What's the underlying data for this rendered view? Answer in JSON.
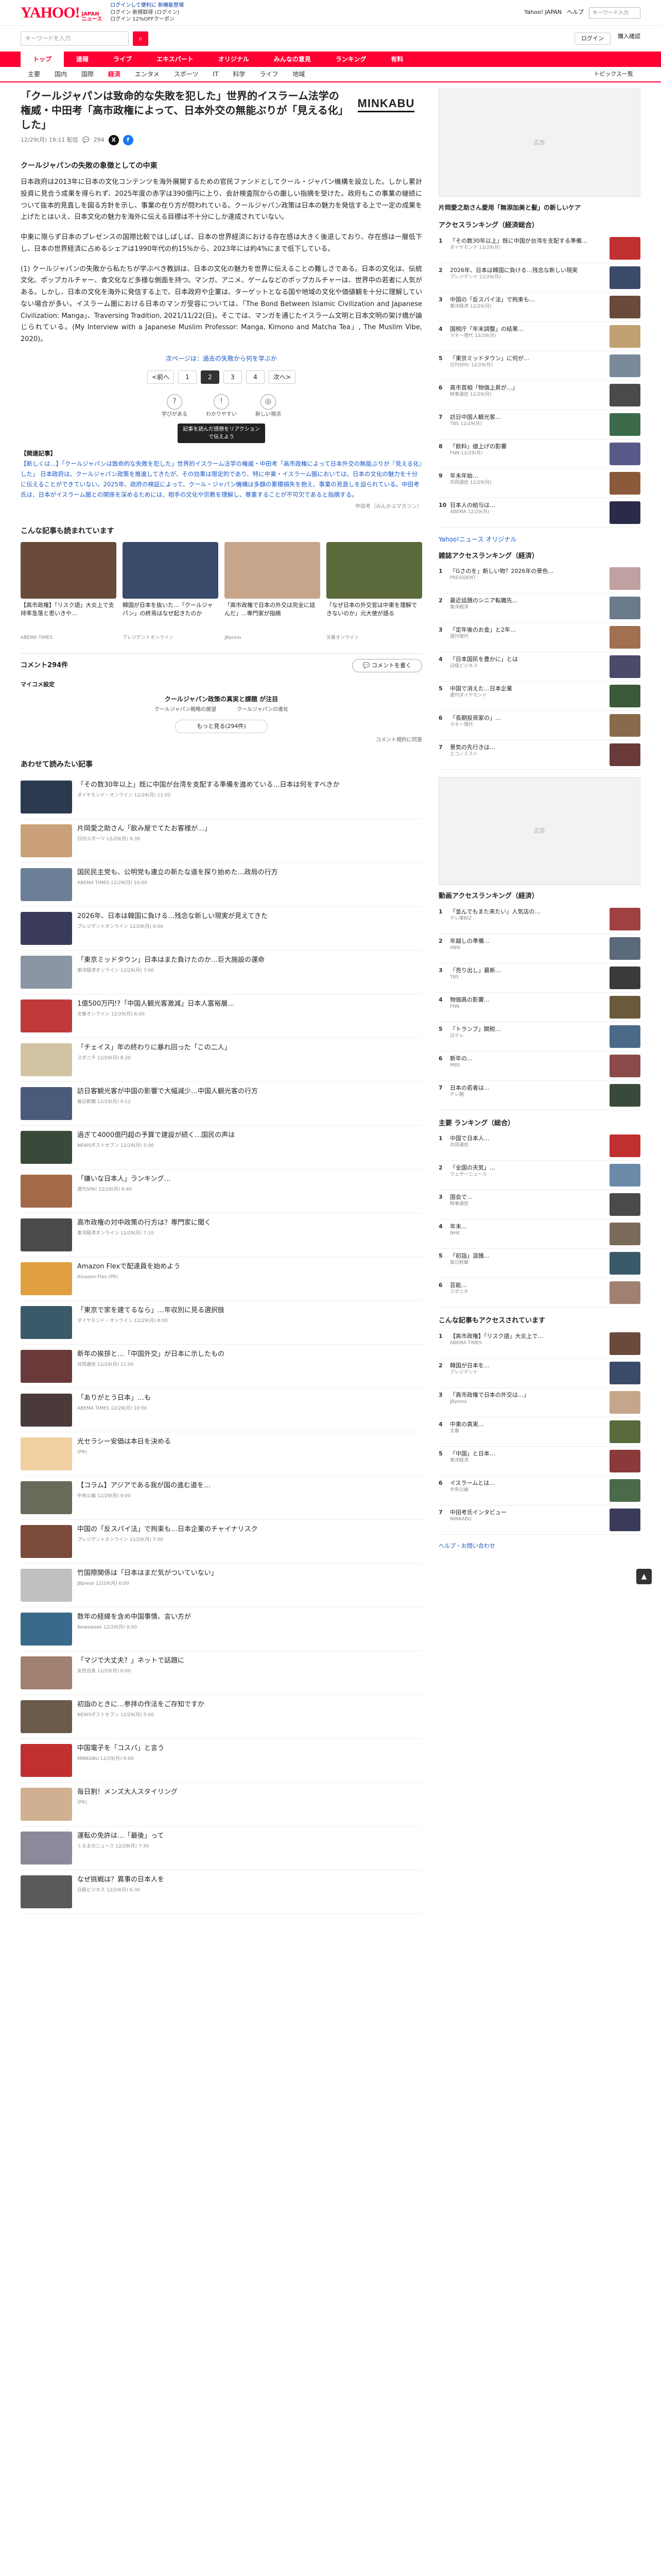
{
  "header": {
    "logo": "YAHOO!",
    "logo_sub": "JAPAN",
    "service": "ニュース",
    "links": [
      "ログインして便利に 新機能登場",
      "ログイン 新規取得 (ログイン)",
      "ログイン 12%OFFクーポン"
    ],
    "right_links": [
      "Yahoo! JAPAN",
      "ヘルプ"
    ],
    "mini_search": "キーワード入力"
  },
  "search": {
    "placeholder": "キーワードを入力",
    "right": [
      "ログイン",
      "購入確認"
    ]
  },
  "nav_primary": [
    "トップ",
    "速報",
    "ライブ",
    "エキスパート",
    "オリジナル",
    "みんなの意見",
    "ランキング",
    "有料"
  ],
  "nav_secondary": [
    "主要",
    "国内",
    "国際",
    "経済",
    "エンタメ",
    "スポーツ",
    "IT",
    "科学",
    "ライフ",
    "地域"
  ],
  "nav_more": "トピックス一覧",
  "article": {
    "title": "「クールジャパンは致命的な失敗を犯した」世界的イスラーム法学の権威・中田考「高市政権によって、日本外交の無能ぶりが「見える化」した」",
    "brand": "MINKABU",
    "date": "12/29(月) 19:11 配信",
    "comments": "294",
    "subheading": "クールジャパンの失敗の象徴としての中東",
    "p1": "日本政府は2013年に日本の文化コンテンツを海外展開するための官民ファンドとしてクール・ジャパン機構を設立した。しかし累計投資に見合う成果を得られず、2025年度の赤字は390億円に上り、会計検査院からの厳しい指摘を受けた。政府もこの事業の継続について抜本的見直しを図る方針を示し、事業の在り方が問われている。クールジャパン政策は日本の魅力を発信する上で一定の成果を上げたとはいえ、日本文化の魅力を海外に伝える目標は不十分にしか達成されていない。",
    "p2": "中東に限らず日本のプレゼンスの国際比較ではしばしば、日本の世界経済における存在感は大きく後退しており、存在感は一層低下し、日本の世界経済に占めるシェアは1990年代の約15%から、2023年には約4%にまで低下している。",
    "p3": "(1) クールジャパンの失敗から私たちが学ぶべき教訓は、日本の文化の魅力を世界に伝えることの難しさである。日本の文化は、伝統文化、ポップカルチャー、食文化など多様な側面を持つ。マンガ、アニメ、ゲームなどのポップカルチャーは、世界中の若者に人気がある。しかし、日本の文化を海外に発信する上で、日本政府や企業は、ターゲットとなる国や地域の文化や価値観を十分に理解していない場合が多い。イスラーム圏における日本のマンガ受容については、「The Bond Between Islamic Civilization and Japanese Civilization: Manga」、Traversing Tradition, 2021/11/22(日)。そこでは、マンガを通じたイスラーム文明と日本文明の架け橋が論じられている。(My Interview with a Japanese Muslim Professor: Manga, Kimono and Matcha Tea」, The Muslim Vibe, 2020)。",
    "refnote": "次ページは：過去の失敗から何を学ぶか",
    "pages": [
      "<前へ",
      "1",
      "2",
      "3",
      "4",
      "次へ>"
    ],
    "current_page": "2",
    "reactions": [
      {
        "label": "学びがある",
        "icon": "?"
      },
      {
        "label": "わかりやすい",
        "icon": "!"
      },
      {
        "label": "新しい視点",
        "icon": "◎"
      }
    ],
    "tooltip": "記事を読んだ感想をリアクションで伝えよう",
    "reference_title": "【関連記事】",
    "reference": "【新しくは...】「クールジャパンは致命的な失敗を犯した」世界的イスラーム法学の権威・中田考「高市政権によって日本外交の無能ぶりが『見える化』した」 日本政府は、クールジャパン政策を推進してきたが、その効果は限定的であり、特に中東・イスラーム圏においては、日本の文化の魅力を十分に伝えることができていない。2025年、政府の検証によって、クール・ジャパン機構は多額の累積損失を抱え、事業の見直しを迫られている。中田考氏は、日本がイスラーム圏との関係を深めるためには、相手の文化や宗教を理解し、尊重することが不可欠であると指摘する。",
    "author": "中田考（みんかぶマガジン）"
  },
  "related_title": "こんな記事も読まれています",
  "related": [
    {
      "title": "【高市政権】「リスク語」大炎上で支持率急落と思いきや…",
      "src": "ABEMA TIMES",
      "color": "#6a4a3a"
    },
    {
      "title": "韓国が日本を抜いた…「クールジャパン」の終焉はなぜ起きたのか",
      "src": "プレジデントオンライン",
      "color": "#3a4a6a"
    },
    {
      "title": "「高市政権で日本の外交は完全に詰んだ」...専門家が指摘",
      "src": "JBpress",
      "color": "#c7a58a"
    },
    {
      "title": "「なぜ日本の外交官は中東を理解できないのか」元大使が語る",
      "src": "文春オンライン",
      "color": "#5a6a3a"
    }
  ],
  "comment_section": {
    "title": "コメント294件",
    "label": "マイコメ設定",
    "expert_title": "クールジャパン政策の真実と課題 が注目",
    "experts": [
      "クールジャパン戦略の展望",
      "クールジャパンの進化"
    ],
    "more": "もっと見る(294件)",
    "agree": "コメント規約に同意"
  },
  "list_title": "あわせて読みたい記事",
  "list": [
    {
      "t": "「その数30年以上」既に中国が台湾を支配する準備を進めている…日本は何をすべきか",
      "s": "ダイヤモンド・オンライン 12/29(月) 11:05",
      "c": "#2b3a4e"
    },
    {
      "t": "片岡愛之助さん「飲み屋でてたお客様が…」",
      "s": "日刊スポーツ 12/29(月) 9:39",
      "c": "#caa17a"
    },
    {
      "t": "国民民主党も、公明党も連立の新たな道を探り始めた…政局の行方",
      "s": "ABEMA TIMES 12/29(月) 10:00",
      "c": "#6b7f96"
    },
    {
      "t": "2026年、日本は韓国に負ける…残念な新しい現実が見えてきた",
      "s": "プレジデントオンライン 12/29(月) 9:00",
      "c": "#3a3a5a"
    },
    {
      "t": "「東京ミッドタウン」日本はまた負けたのか…巨大施設の運命",
      "s": "東洋経済オンライン 12/29(月) 7:00",
      "c": "#8a96a3"
    },
    {
      "t": "1億500万円!?「中国人観光客激減」日本人富裕層…",
      "s": "文春オンライン 12/29(月) 6:00",
      "c": "#c03a3a"
    },
    {
      "t": "「チェイス」年の終わりに暴れ回った「この二人」",
      "s": "スポニチ 12/29(月) 8:20",
      "c": "#d2c3a2"
    },
    {
      "t": "訪日客観光客が中国の影響で大幅減少…中国人観光客の行方",
      "s": "毎日新聞 12/29(月) 9:12",
      "c": "#4a5a7a"
    },
    {
      "t": "過ぎて4000億円超の予算で建設が続く…国民の声は",
      "s": "NEWSポストセブン 12/29(月) 5:00",
      "c": "#3a4a3a"
    },
    {
      "t": "「嫌いな日本人」ランキング…",
      "s": "週刊SPA! 12/29(月) 6:40",
      "c": "#a36a4a"
    },
    {
      "t": "高市政権の対中政策の行方は？専門家に聞く",
      "s": "東洋経済オンライン 12/29(月) 7:10",
      "c": "#4a4a4a"
    },
    {
      "t": "Amazon Flexで配達員を始めよう",
      "s": "Amazon Flex (PR)",
      "c": "#e0a040"
    },
    {
      "t": "「東京で家を建てるなら」…年収別に見る選択肢",
      "s": "ダイヤモンド・オンライン 12/29(月) 8:00",
      "c": "#3a5a6a"
    },
    {
      "t": "新年の挨拶と…「中国外交」が日本に示したもの",
      "s": "共同通信 12/29(月) 11:00",
      "c": "#6a3a3a"
    },
    {
      "t": "「ありがとう日本」…も",
      "s": "ABEMA TIMES 12/29(月) 10:00",
      "c": "#4a3a3a"
    },
    {
      "t": "光セラシー安価は本日を決める",
      "s": "(PR)",
      "c": "#f0d0a0"
    },
    {
      "t": "【コラム】アジアである我が国の進む道を…",
      "s": "中央公論 12/29(月) 9:00",
      "c": "#6a6a5a"
    },
    {
      "t": "中国の「反スパイ法」で拘束も…日本企業のチャイナリスク",
      "s": "プレジデントオンライン 12/29(月) 7:00",
      "c": "#7a4a3a"
    },
    {
      "t": "竹国際関係は「日本はまだ気がついていない」",
      "s": "JBpress 12/29(月) 6:00",
      "c": "#c0c0c0"
    },
    {
      "t": "数年の経緯を含め中国事情、言い方が",
      "s": "Newsweek 12/29(月) 9:00",
      "c": "#3a6a8a"
    },
    {
      "t": "「マジで大丈夫？」ネットで話題に",
      "s": "女性自身 12/29(月) 8:00",
      "c": "#a08070"
    },
    {
      "t": "初詣のときに…参拝の作法をご存知ですか",
      "s": "NEWSポストセブン 12/29(月) 5:00",
      "c": "#6a5a4a"
    },
    {
      "t": "中国電子を「コスパ」と言う",
      "s": "MINKABU 12/29(月) 9:00",
      "c": "#c03030"
    },
    {
      "t": "毎日割！メンズ大人スタイリング",
      "s": "(PR)",
      "c": "#d0b090"
    },
    {
      "t": "運転の免許は…「最後」って",
      "s": "くるまのニュース 12/29(月) 7:30",
      "c": "#8a8a9a"
    },
    {
      "t": "なぜ挑戦は？異事の日本人を",
      "s": "日経ビジネス 12/29(月) 6:30",
      "c": "#5a5a5a"
    }
  ],
  "sidebar": {
    "ad1": "広告",
    "ad1_title": "片岡愛之助さん愛用「無添加美と髪」の新しいケア",
    "ranking_title": "アクセスランキング（経済総合）",
    "ranking": [
      {
        "t": "「その数30年以上」既に中国が台湾を支配する準備…",
        "s": "ダイヤモンド 12/29(月)",
        "c": "#c03030"
      },
      {
        "t": "2026年、日本は韓国に負ける…残念な新しい現実",
        "s": "プレジデント 12/29(月)",
        "c": "#3a4a6a"
      },
      {
        "t": "中国の「反スパイ法」で拘束も…",
        "s": "東洋経済 12/29(月)",
        "c": "#6a4a3a"
      },
      {
        "t": "国税庁「年末調整」の結果…",
        "s": "マネー現代 12/29(月)",
        "c": "#c0a070"
      },
      {
        "t": "「東京ミッドタウン」に何が…",
        "s": "日刊SPA! 12/29(月)",
        "c": "#7a8a9a"
      },
      {
        "t": "高市首相「物価上昇が…」",
        "s": "時事通信 12/29(月)",
        "c": "#4a4a4a"
      },
      {
        "t": "訪日中国人観光客…",
        "s": "TBS 12/29(月)",
        "c": "#3a6a4a"
      },
      {
        "t": "「飲料」値上げの影響",
        "s": "FNN 12/29(月)",
        "c": "#5a5a8a"
      },
      {
        "t": "年末年始…",
        "s": "共同通信 12/29(月)",
        "c": "#8a5a3a"
      },
      {
        "t": "日本人の給与は…",
        "s": "ABEMA 12/29(月)",
        "c": "#2a2a4a"
      }
    ],
    "yahoo_link": "Yahoo!ニュース オリジナル",
    "ranking2_title": "雑誌アクセスランキング（経済）",
    "ranking2": [
      {
        "t": "「Gさのを」新しい物？2026年の景色…",
        "s": "PRESIDENT",
        "c": "#c0a0a0"
      },
      {
        "t": "最近話題のシニア転職先…",
        "s": "東洋経済",
        "c": "#6a7a8a"
      },
      {
        "t": "「定年後のお金」と2年…",
        "s": "週刊現代",
        "c": "#a07050"
      },
      {
        "t": "「日本国民を豊かに」とは",
        "s": "日経ビジネス",
        "c": "#4a4a6a"
      },
      {
        "t": "中国で消えた…日本企業",
        "s": "週刊ダイヤモンド",
        "c": "#3a5a3a"
      },
      {
        "t": "「長期投資家の」…",
        "s": "マネー現代",
        "c": "#8a6a4a"
      },
      {
        "t": "景気の先行きは…",
        "s": "エコノミスト",
        "c": "#6a3a3a"
      }
    ],
    "ad2": "広告",
    "ranking3_title": "動画アクセスランキング（経済）",
    "ranking3": [
      {
        "t": "「並んでもまた来たい」人気店の…",
        "s": "テレ東BIZ",
        "c": "#a04040"
      },
      {
        "t": "年越しの準備…",
        "s": "ANN",
        "c": "#5a6a7a"
      },
      {
        "t": "「売り出し」最新…",
        "s": "TBS",
        "c": "#3a3a3a"
      },
      {
        "t": "物価高の影響…",
        "s": "FNN",
        "c": "#6a5a3a"
      },
      {
        "t": "「トランプ」関税…",
        "s": "日テレ",
        "c": "#4a6a8a"
      },
      {
        "t": "新年の…",
        "s": "MBS",
        "c": "#8a4a4a"
      },
      {
        "t": "日本の若者は…",
        "s": "テレ朝",
        "c": "#3a4a3a"
      }
    ],
    "ranking4_title": "主要 ランキング（総合）",
    "ranking4": [
      {
        "t": "中国で日本人…",
        "s": "共同通信",
        "c": "#c03030"
      },
      {
        "t": "「全国の天気」…",
        "s": "ウェザーニュース",
        "c": "#6a8aaa"
      },
      {
        "t": "国会で…",
        "s": "時事通信",
        "c": "#4a4a4a"
      },
      {
        "t": "年末…",
        "s": "NHK",
        "c": "#7a6a5a"
      },
      {
        "t": "「初詣」混雑…",
        "s": "毎日新聞",
        "c": "#3a5a6a"
      },
      {
        "t": "芸能…",
        "s": "スポニチ",
        "c": "#a08070"
      }
    ],
    "ranking5_title": "こんな記事もアクセスされています",
    "ranking5": [
      {
        "t": "【高市政権】「リスク語」大炎上で…",
        "s": "ABEMA TIMES",
        "c": "#6a4a3a"
      },
      {
        "t": "韓国が日本を…",
        "s": "プレジデント",
        "c": "#3a4a6a"
      },
      {
        "t": "「高市政権で日本の外交は…」",
        "s": "JBpress",
        "c": "#c7a58a"
      },
      {
        "t": "中東の真実…",
        "s": "文春",
        "c": "#5a6a3a"
      },
      {
        "t": "「中国」と日本…",
        "s": "東洋経済",
        "c": "#8a3a3a"
      },
      {
        "t": "イスラームとは…",
        "s": "中央公論",
        "c": "#4a6a4a"
      },
      {
        "t": "中田考氏インタビュー",
        "s": "MINKABU",
        "c": "#3a3a5a"
      }
    ],
    "footer_link": "ヘルプ・お問い合わせ"
  },
  "pagetop": "▲"
}
